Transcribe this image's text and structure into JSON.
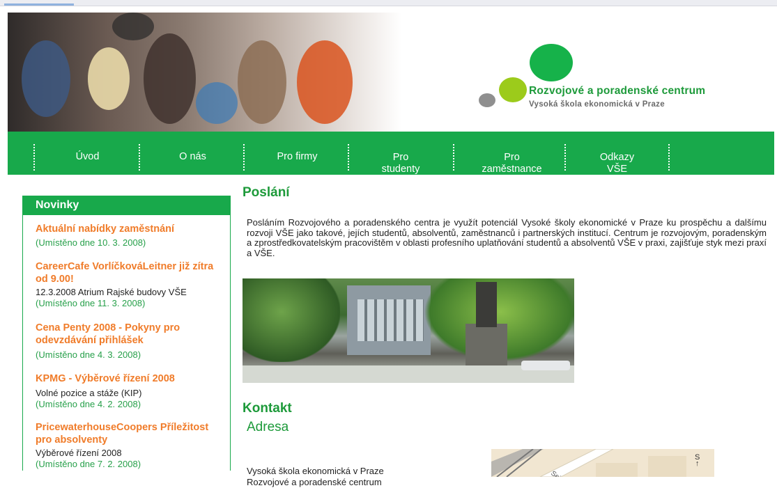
{
  "header": {
    "logo_title": "Rozvojové a poradenské centrum",
    "logo_subtitle": "Vysoká škola ekonomická v Praze"
  },
  "nav": {
    "items": [
      {
        "lines": [
          "Úvod"
        ]
      },
      {
        "lines": [
          "O nás"
        ]
      },
      {
        "lines": [
          "Pro firmy"
        ]
      },
      {
        "lines": [
          "Pro",
          "studenty"
        ]
      },
      {
        "lines": [
          "Pro",
          "zaměstnance"
        ]
      },
      {
        "lines": [
          "Odkazy",
          "VŠE"
        ]
      }
    ]
  },
  "sidebar": {
    "heading": "Novinky",
    "news": [
      {
        "title": "Aktuální nabídky zaměstnání",
        "text": "",
        "date": "(Umístěno dne 10. 3. 2008)"
      },
      {
        "title": "CareerCafe VorlíčkováLeitner již zítra od 9.00!",
        "text": "12.3.2008 Atrium Rajské budovy VŠE",
        "date": "(Umístěno dne 11. 3. 2008)"
      },
      {
        "title": "Cena Penty 2008 - Pokyny pro odevzdávání přihlášek",
        "text": "",
        "date": "(Umístěno dne 4. 3. 2008)"
      },
      {
        "title": "KPMG - Výběrové řízení 2008",
        "text": "Volné pozice a stáže (KIP)",
        "date": "(Umístěno dne 4. 2. 2008)"
      },
      {
        "title": "PricewaterhouseCoopers Příležitost pro absolventy",
        "text": "Výběrové řízení 2008",
        "date": "(Umístěno dne 7. 2. 2008)"
      }
    ]
  },
  "main": {
    "mission_heading": "Poslání",
    "mission_text": "Posláním Rozvojového a poradenského centra je využít potenciál Vysoké školy ekonomické v Praze ku prospěchu a dalšímu rozvoji VŠE jako takové, jejích studentů, absolventů, zaměstnanců i partnerských institucí. Centrum je rozvojovým, poradenským a zprostředkovatelským pracovištěm v oblasti profesního uplatňování studentů a absolventů VŠE v praxi, zajišťuje styk mezi praxí a VŠE.",
    "contact_heading": "Kontakt",
    "address_heading": "Adresa",
    "address_lines": [
      "Vysoká škola ekonomická v Praze",
      "Rozvojové a poradenské centrum"
    ],
    "map_street_label": "Seifertova"
  },
  "colors": {
    "brand_green": "#18a94b",
    "heading_green": "#1d9a3a",
    "news_orange": "#f07c2a"
  }
}
